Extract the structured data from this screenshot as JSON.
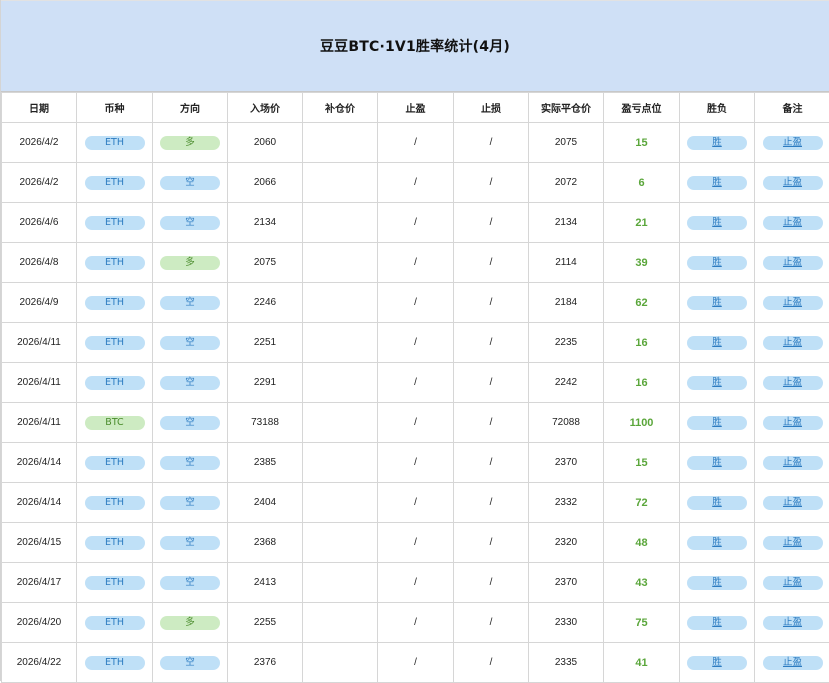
{
  "title": "豆豆BTC·1V1胜率统计(4月)",
  "colors": {
    "title_bg": "#cfe0f6",
    "pill_blue": "#bfe0f7",
    "pill_green": "#cdebc2",
    "points_green": "#5aa63a"
  },
  "headers": [
    "日期",
    "币种",
    "方向",
    "入场价",
    "补仓价",
    "止盈",
    "止损",
    "实际平仓价",
    "盈亏点位",
    "胜负",
    "备注"
  ],
  "rows": [
    {
      "date": "2026/4/2",
      "coin": "ETH",
      "coin_color": "blue",
      "direction": "多",
      "direction_color": "green",
      "entry": "2060",
      "add": "",
      "tp": "/",
      "sl": "/",
      "close": "2075",
      "points": "15",
      "result": "胜",
      "note": "止盈"
    },
    {
      "date": "2026/4/2",
      "coin": "ETH",
      "coin_color": "blue",
      "direction": "空",
      "direction_color": "blue",
      "entry": "2066",
      "add": "",
      "tp": "/",
      "sl": "/",
      "close": "2072",
      "points": "6",
      "result": "胜",
      "note": "止盈"
    },
    {
      "date": "2026/4/6",
      "coin": "ETH",
      "coin_color": "blue",
      "direction": "空",
      "direction_color": "blue",
      "entry": "2134",
      "add": "",
      "tp": "/",
      "sl": "/",
      "close": "2134",
      "points": "21",
      "result": "胜",
      "note": "止盈"
    },
    {
      "date": "2026/4/8",
      "coin": "ETH",
      "coin_color": "blue",
      "direction": "多",
      "direction_color": "green",
      "entry": "2075",
      "add": "",
      "tp": "/",
      "sl": "/",
      "close": "2114",
      "points": "39",
      "result": "胜",
      "note": "止盈"
    },
    {
      "date": "2026/4/9",
      "coin": "ETH",
      "coin_color": "blue",
      "direction": "空",
      "direction_color": "blue",
      "entry": "2246",
      "add": "",
      "tp": "/",
      "sl": "/",
      "close": "2184",
      "points": "62",
      "result": "胜",
      "note": "止盈"
    },
    {
      "date": "2026/4/11",
      "coin": "ETH",
      "coin_color": "blue",
      "direction": "空",
      "direction_color": "blue",
      "entry": "2251",
      "add": "",
      "tp": "/",
      "sl": "/",
      "close": "2235",
      "points": "16",
      "result": "胜",
      "note": "止盈"
    },
    {
      "date": "2026/4/11",
      "coin": "ETH",
      "coin_color": "blue",
      "direction": "空",
      "direction_color": "blue",
      "entry": "2291",
      "add": "",
      "tp": "/",
      "sl": "/",
      "close": "2242",
      "points": "16",
      "result": "胜",
      "note": "止盈"
    },
    {
      "date": "2026/4/11",
      "coin": "BTC",
      "coin_color": "green",
      "direction": "空",
      "direction_color": "blue",
      "entry": "73188",
      "add": "",
      "tp": "/",
      "sl": "/",
      "close": "72088",
      "points": "1100",
      "result": "胜",
      "note": "止盈"
    },
    {
      "date": "2026/4/14",
      "coin": "ETH",
      "coin_color": "blue",
      "direction": "空",
      "direction_color": "blue",
      "entry": "2385",
      "add": "",
      "tp": "/",
      "sl": "/",
      "close": "2370",
      "points": "15",
      "result": "胜",
      "note": "止盈"
    },
    {
      "date": "2026/4/14",
      "coin": "ETH",
      "coin_color": "blue",
      "direction": "空",
      "direction_color": "blue",
      "entry": "2404",
      "add": "",
      "tp": "/",
      "sl": "/",
      "close": "2332",
      "points": "72",
      "result": "胜",
      "note": "止盈"
    },
    {
      "date": "2026/4/15",
      "coin": "ETH",
      "coin_color": "blue",
      "direction": "空",
      "direction_color": "blue",
      "entry": "2368",
      "add": "",
      "tp": "/",
      "sl": "/",
      "close": "2320",
      "points": "48",
      "result": "胜",
      "note": "止盈"
    },
    {
      "date": "2026/4/17",
      "coin": "ETH",
      "coin_color": "blue",
      "direction": "空",
      "direction_color": "blue",
      "entry": "2413",
      "add": "",
      "tp": "/",
      "sl": "/",
      "close": "2370",
      "points": "43",
      "result": "胜",
      "note": "止盈"
    },
    {
      "date": "2026/4/20",
      "coin": "ETH",
      "coin_color": "blue",
      "direction": "多",
      "direction_color": "green",
      "entry": "2255",
      "add": "",
      "tp": "/",
      "sl": "/",
      "close": "2330",
      "points": "75",
      "result": "胜",
      "note": "止盈"
    },
    {
      "date": "2026/4/22",
      "coin": "ETH",
      "coin_color": "blue",
      "direction": "空",
      "direction_color": "blue",
      "entry": "2376",
      "add": "",
      "tp": "/",
      "sl": "/",
      "close": "2335",
      "points": "41",
      "result": "胜",
      "note": "止盈"
    }
  ]
}
